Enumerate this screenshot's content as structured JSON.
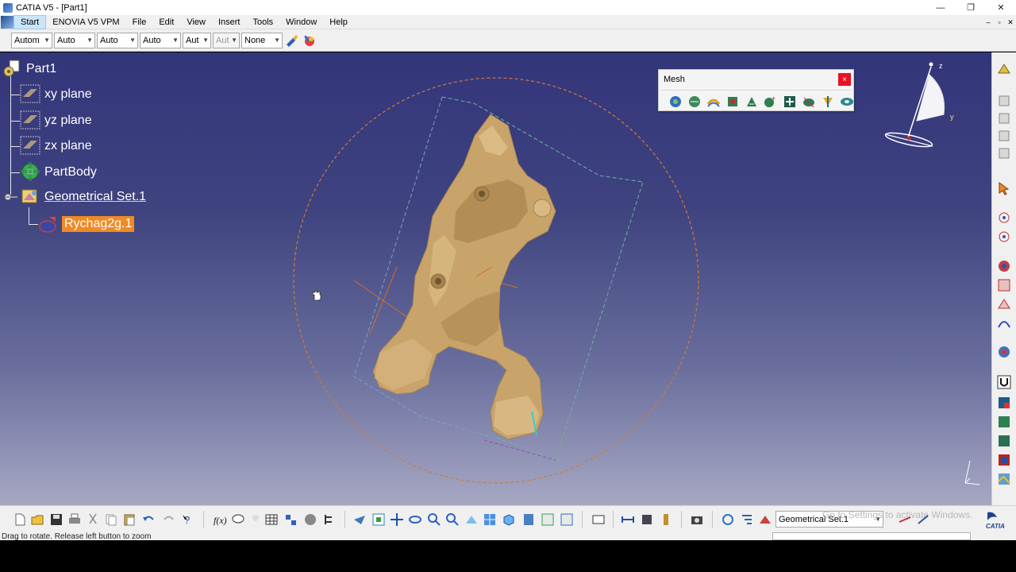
{
  "window": {
    "title": "CATIA V5 - [Part1]",
    "controls": [
      "—",
      "❐",
      "✕"
    ]
  },
  "menubar": {
    "items": [
      "Start",
      "ENOVIA V5 VPM",
      "File",
      "Edit",
      "View",
      "Insert",
      "Tools",
      "Window",
      "Help"
    ],
    "mdi_controls": [
      "–",
      "▫",
      "✕"
    ]
  },
  "toolbar": {
    "combos": [
      {
        "value": "Autom",
        "disabled": false
      },
      {
        "value": "Auto",
        "disabled": false
      },
      {
        "value": "Auto",
        "disabled": false
      },
      {
        "value": "Auto",
        "disabled": false
      },
      {
        "value": "Aut",
        "disabled": false
      },
      {
        "value": "Aut",
        "disabled": true
      },
      {
        "value": "None",
        "disabled": false
      }
    ]
  },
  "tree": {
    "root": "Part1",
    "items": [
      {
        "label": "xy plane",
        "icon": "plane-icon"
      },
      {
        "label": "yz plane",
        "icon": "plane-icon"
      },
      {
        "label": "zx plane",
        "icon": "plane-icon"
      },
      {
        "label": "PartBody",
        "icon": "partbody-icon"
      },
      {
        "label": "Geometrical Set.1",
        "icon": "geometrical-set-icon"
      }
    ],
    "child": {
      "label": "Rychag2g.1",
      "icon": "mesh-icon",
      "selected": true
    }
  },
  "mesh_toolbar": {
    "title": "Mesh",
    "close": "×",
    "icons": [
      "mesh-creation-icon",
      "mesh-cleaner-icon",
      "mesh-offset-icon",
      "mesh-smooth-icon",
      "mesh-decimate-icon",
      "mesh-merge-icon",
      "mesh-split-icon",
      "mesh-trim-icon",
      "mesh-flip-icon",
      "mesh-fill-holes-icon"
    ]
  },
  "compass": {
    "axes": [
      "z",
      "y"
    ]
  },
  "bottom": {
    "current_set": "Geometrical Set.1",
    "watermark": "Go to Settings to activate Windows."
  },
  "status": {
    "message": "Drag to rotate. Release left button to zoom"
  },
  "colors": {
    "viewport_top": "#33357a",
    "viewport_bottom": "#a6a8c3",
    "part_color": "#c9a46a",
    "selection": "#f08a24",
    "bounding_sphere": "#d07a3a"
  }
}
